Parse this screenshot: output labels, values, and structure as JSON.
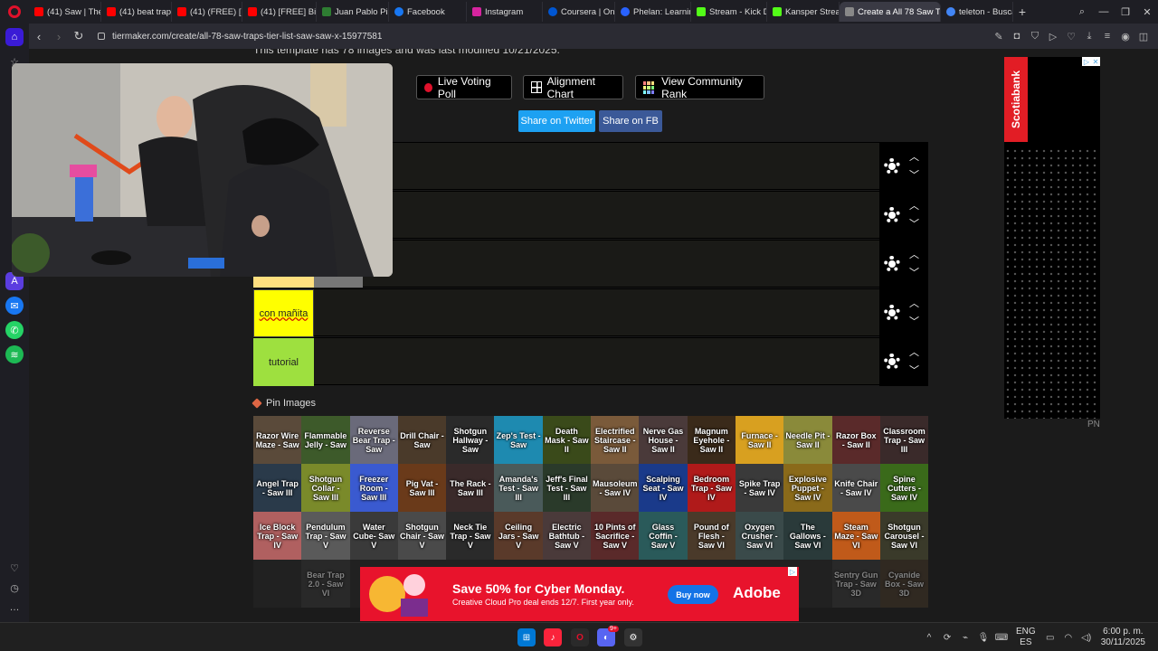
{
  "browser": {
    "tabs": [
      {
        "label": "(41) Saw | The B",
        "fav": "#ff0000"
      },
      {
        "label": "(41) beat trap dr",
        "fav": "#ff0000"
      },
      {
        "label": "(41) (FREE) [HAR",
        "fav": "#ff0000"
      },
      {
        "label": "(41) [FREE] Big S",
        "fav": "#ff0000"
      },
      {
        "label": "Juan Pablo Piam",
        "fav": "#2e7d32"
      },
      {
        "label": "Facebook",
        "fav": "#1877f2"
      },
      {
        "label": "Instagram",
        "fav": "#d6249f"
      },
      {
        "label": "Coursera | Onlin",
        "fav": "#0056d2"
      },
      {
        "label": "Phelan: Learning",
        "fav": "#2962ff"
      },
      {
        "label": "Stream - Kick Da",
        "fav": "#53fc18"
      },
      {
        "label": "Kansper Stream",
        "fav": "#53fc18"
      },
      {
        "label": "Create a All 78 Saw Traps",
        "fav": "#888888"
      },
      {
        "label": "teleton - Buscar",
        "fav": "#4285f4"
      }
    ],
    "url": "tiermaker.com/create/all-78-saw-traps-tier-list-saw-saw-x-15977581"
  },
  "page": {
    "template_note": "This template has 78 images and was last modified 10/21/2025.",
    "buttons": {
      "live_voting": "Live Voting Poll",
      "alignment": "Alignment Chart",
      "community_rank": "View Community Rank",
      "share_twitter": "Share on Twitter",
      "share_fb": "Share on FB"
    },
    "tiers": [
      {
        "label": "",
        "color": ""
      },
      {
        "label": "",
        "color": ""
      },
      {
        "label": "",
        "color": ""
      },
      {
        "label": "con mañita",
        "color": "#ffff00"
      },
      {
        "label": "tutorial",
        "color": "#9ee03f"
      }
    ],
    "pin_label": "Pin Images",
    "images": [
      "Razor Wire Maze - Saw",
      "Flammable Jelly - Saw",
      "Reverse Bear Trap - Saw",
      "Drill Chair - Saw",
      "Shotgun Hallway - Saw",
      "Zep's Test - Saw",
      "Death Mask - Saw II",
      "Electrified Staircase - Saw II",
      "Nerve Gas House - Saw II",
      "Magnum Eyehole - Saw II",
      "Furnace - Saw II",
      "Needle Pit - Saw II",
      "Razor Box - Saw II",
      "Classroom Trap - Saw III",
      "Angel Trap - Saw III",
      "Shotgun Collar - Saw III",
      "Freezer Room - Saw III",
      "Pig Vat - Saw III",
      "The Rack - Saw III",
      "Amanda's Test - Saw III",
      "Jeff's Final Test - Saw III",
      "Mausoleum - Saw IV",
      "Scalping Seat - Saw IV",
      "Bedroom Trap - Saw IV",
      "Spike Trap - Saw IV",
      "Explosive Puppet - Saw IV",
      "Knife Chair - Saw IV",
      "Spine Cutters - Saw IV",
      "Ice Block Trap - Saw IV",
      "Pendulum Trap - Saw V",
      "Water Cube- Saw V",
      "Shotgun Chair - Saw V",
      "Neck Tie Trap - Saw V",
      "Ceiling Jars - Saw V",
      "Electric Bathtub - Saw V",
      "10 Pints of Sacrifice - Saw V",
      "Glass Coffin - Saw V",
      "Pound of Flesh - Saw VI",
      "Oxygen Crusher - Saw VI",
      "The Gallows - Saw VI",
      "Steam Maze - Saw VI",
      "Shotgun Carousel - Saw VI",
      "",
      "Bear Trap 2.0 - Saw VI",
      "",
      "",
      "",
      "",
      "",
      "",
      "",
      "",
      "",
      "",
      "Sentry Gun Trap - Saw 3D",
      "Cyanide Box - Saw 3D"
    ]
  },
  "ads": {
    "right_brand": "Scotiabank",
    "pn": "PN",
    "bottom_promo": "Save 50% for Cyber Monday.",
    "bottom_sub": "Creative Cloud Pro deal ends 12/7. First year only.",
    "bottom_cta": "Buy now",
    "bottom_brand": "Adobe"
  },
  "taskbar": {
    "lang": "ENG",
    "region": "ES",
    "time": "6:00 p. m.",
    "date": "30/11/2025",
    "discord_badge": "9+"
  }
}
